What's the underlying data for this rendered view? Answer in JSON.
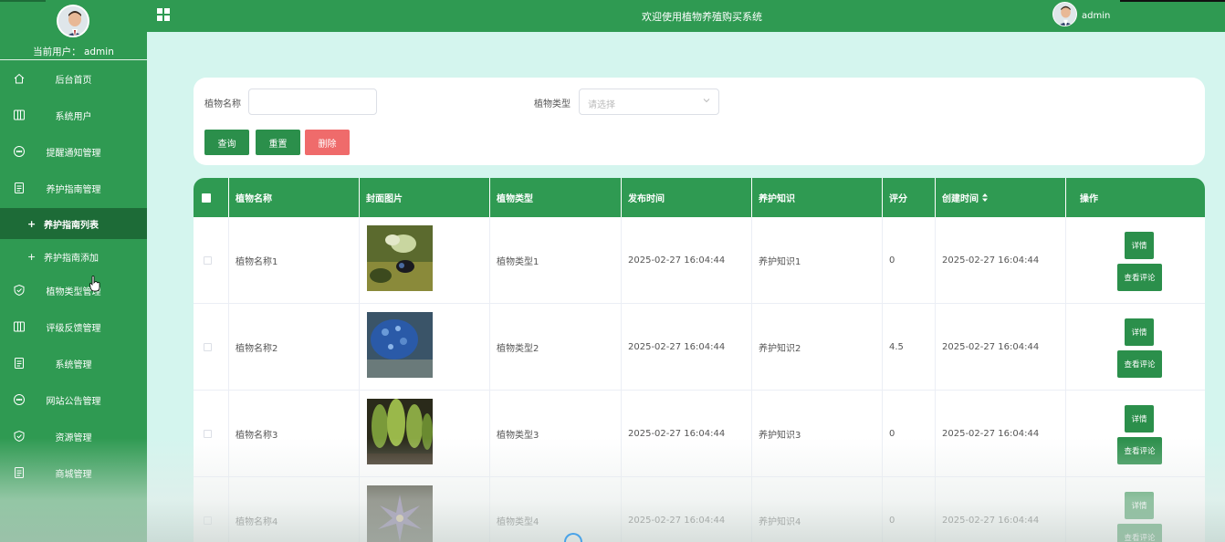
{
  "sidebar": {
    "current_user": "当前用户： admin",
    "menu": [
      {
        "label": "后台首页",
        "icon": "home-icon"
      },
      {
        "label": "系统用户",
        "icon": "columns-icon"
      },
      {
        "label": "提醒通知管理",
        "icon": "chat-icon"
      },
      {
        "label": "养护指南管理",
        "icon": "document-icon"
      },
      {
        "label": "植物类型管理",
        "icon": "shield-icon"
      },
      {
        "label": "评级反馈管理",
        "icon": "columns-icon"
      },
      {
        "label": "系统管理",
        "icon": "document-icon"
      },
      {
        "label": "网站公告管理",
        "icon": "chat-icon"
      },
      {
        "label": "资源管理",
        "icon": "shield-icon"
      },
      {
        "label": "商城管理",
        "icon": "document-icon"
      }
    ],
    "submenu": [
      {
        "label": "养护指南列表",
        "active": true
      },
      {
        "label": "养护指南添加",
        "active": false
      }
    ],
    "plus": "+"
  },
  "header": {
    "title": "欢迎使用植物养殖购买系统",
    "user": "admin"
  },
  "search": {
    "name_label": "植物名称",
    "name_value": "",
    "type_label": "植物类型",
    "type_placeholder": "请选择",
    "query_button": "查询",
    "reset_button": "重置",
    "delete_button": "删除"
  },
  "table": {
    "columns": [
      "植物名称",
      "封面图片",
      "植物类型",
      "发布时间",
      "养护知识",
      "评分",
      "创建时间",
      "操作"
    ],
    "rows": [
      {
        "name": "植物名称1",
        "type": "植物类型1",
        "publish_time": "2025-02-27 16:04:44",
        "knowledge": "养护知识1",
        "score": "0",
        "created": "2025-02-27 16:04:44"
      },
      {
        "name": "植物名称2",
        "type": "植物类型2",
        "publish_time": "2025-02-27 16:04:44",
        "knowledge": "养护知识2",
        "score": "4.5",
        "created": "2025-02-27 16:04:44"
      },
      {
        "name": "植物名称3",
        "type": "植物类型3",
        "publish_time": "2025-02-27 16:04:44",
        "knowledge": "养护知识3",
        "score": "0",
        "created": "2025-02-27 16:04:44"
      },
      {
        "name": "植物名称4",
        "type": "植物类型4",
        "publish_time": "2025-02-27 16:04:44",
        "knowledge": "养护知识4",
        "score": "0",
        "created": "2025-02-27 16:04:44"
      }
    ],
    "detail_button": "详情",
    "comments_button": "查看评论"
  },
  "colors": {
    "primary": "#2f9a52",
    "primary_dark": "#1d6b37",
    "background": "#d4f5ee",
    "danger": "#ef6b6b"
  }
}
